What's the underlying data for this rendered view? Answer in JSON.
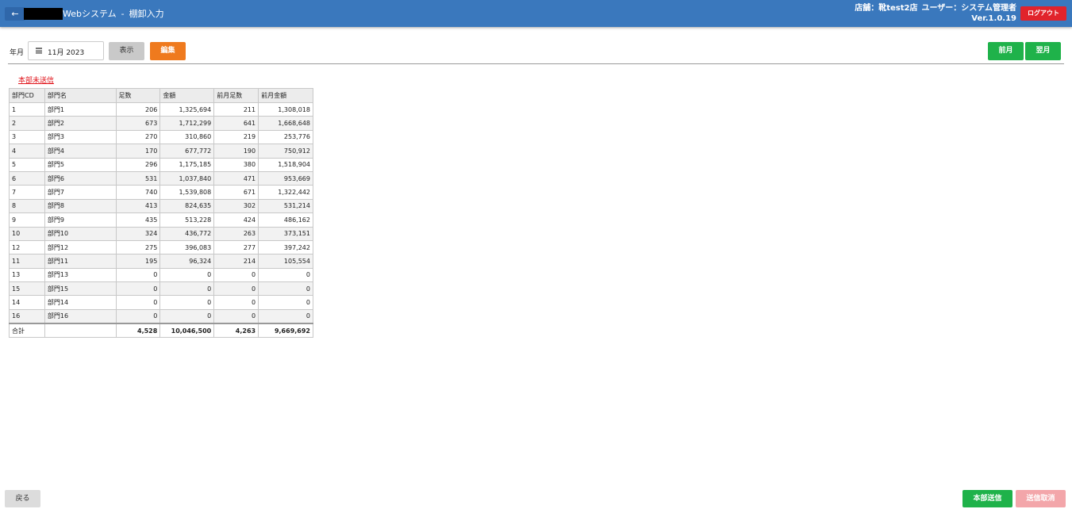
{
  "header": {
    "back_label": "←",
    "title": "Webシステム",
    "separator": "-",
    "subtitle": "棚卸入力",
    "store": "店舗：靴test2店",
    "user": "ユーザー：システム管理者",
    "version": "Ver.1.0.19",
    "logout_label": "ログアウト"
  },
  "toolbar": {
    "ym_label": "年月",
    "date_value": "11月 2023",
    "show_label": "表示",
    "edit_label": "編集",
    "prev_label": "前月",
    "next_label": "翌月"
  },
  "status_link": "本部未送信",
  "table": {
    "headers": [
      "部門CD",
      "部門名",
      "足数",
      "金額",
      "前月足数",
      "前月金額"
    ],
    "rows": [
      [
        "1",
        "部門1",
        "206",
        "1,325,694",
        "211",
        "1,308,018"
      ],
      [
        "2",
        "部門2",
        "673",
        "1,712,299",
        "641",
        "1,668,648"
      ],
      [
        "3",
        "部門3",
        "270",
        "310,860",
        "219",
        "253,776"
      ],
      [
        "4",
        "部門4",
        "170",
        "677,772",
        "190",
        "750,912"
      ],
      [
        "5",
        "部門5",
        "296",
        "1,175,185",
        "380",
        "1,518,904"
      ],
      [
        "6",
        "部門6",
        "531",
        "1,037,840",
        "471",
        "953,669"
      ],
      [
        "7",
        "部門7",
        "740",
        "1,539,808",
        "671",
        "1,322,442"
      ],
      [
        "8",
        "部門8",
        "413",
        "824,635",
        "302",
        "531,214"
      ],
      [
        "9",
        "部門9",
        "435",
        "513,228",
        "424",
        "486,162"
      ],
      [
        "10",
        "部門10",
        "324",
        "436,772",
        "263",
        "373,151"
      ],
      [
        "12",
        "部門12",
        "275",
        "396,083",
        "277",
        "397,242"
      ],
      [
        "11",
        "部門11",
        "195",
        "96,324",
        "214",
        "105,554"
      ],
      [
        "13",
        "部門13",
        "0",
        "0",
        "0",
        "0"
      ],
      [
        "15",
        "部門15",
        "0",
        "0",
        "0",
        "0"
      ],
      [
        "14",
        "部門14",
        "0",
        "0",
        "0",
        "0"
      ],
      [
        "16",
        "部門16",
        "0",
        "0",
        "0",
        "0"
      ]
    ],
    "total": [
      "合計",
      "",
      "4,528",
      "10,046,500",
      "4,263",
      "9,669,692"
    ]
  },
  "footer": {
    "back_label": "戻る",
    "send_label": "本部送信",
    "cancel_label": "送信取消"
  },
  "colors": {
    "header": "#3a78bd",
    "logout": "#e1232b",
    "edit": "#ef7a1e",
    "green": "#1fb24a",
    "cancel_disabled": "#f3a6aa"
  }
}
